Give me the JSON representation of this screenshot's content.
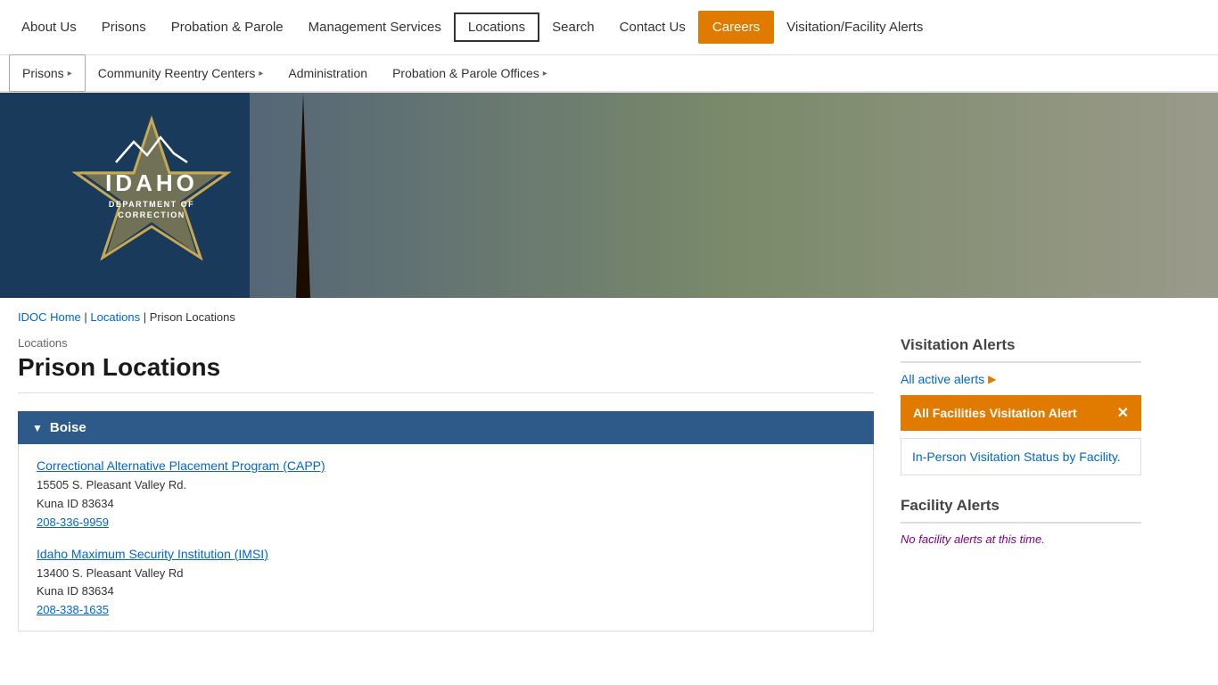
{
  "nav": {
    "items": [
      {
        "label": "About Us",
        "href": "#"
      },
      {
        "label": "Prisons",
        "href": "#"
      },
      {
        "label": "Probation & Parole",
        "href": "#"
      },
      {
        "label": "Management Services",
        "href": "#"
      },
      {
        "label": "Locations",
        "href": "#"
      },
      {
        "label": "Search",
        "href": "#"
      },
      {
        "label": "Contact Us",
        "href": "#"
      },
      {
        "label": "Careers",
        "href": "#"
      },
      {
        "label": "Visitation/Facility Alerts",
        "href": "#"
      }
    ]
  },
  "subnav": {
    "items": [
      {
        "label": "Prisons",
        "active": true
      },
      {
        "label": "Community Reentry Centers"
      },
      {
        "label": "Administration"
      },
      {
        "label": "Probation & Parole Offices"
      }
    ]
  },
  "logo": {
    "title_line1": "IDAHO",
    "title_line2": "DEPARTMENT OF",
    "title_line3": "CORRECTION"
  },
  "breadcrumb": {
    "home": "IDOC Home",
    "separator1": " | ",
    "locations": "Locations",
    "separator2": " | ",
    "current": "Prison Locations"
  },
  "page": {
    "category": "Locations",
    "title": "Prison Locations"
  },
  "locations": [
    {
      "city": "Boise",
      "facilities": [
        {
          "name": "Correctional Alternative Placement Program (CAPP)",
          "address1": "15505 S. Pleasant Valley Rd.",
          "address2": "Kuna ID 83634",
          "phone": "208-336-9959"
        },
        {
          "name": "Idaho Maximum Security Institution (IMSI)",
          "address1": "13400 S. Pleasant Valley Rd",
          "address2": "Kuna ID 83634",
          "phone": "208-338-1635"
        }
      ]
    }
  ],
  "sidebar": {
    "visitation_title": "Visitation Alerts",
    "all_alerts_link": "All active alerts",
    "alert_banner_label": "All Facilities Visitation Alert",
    "alert_detail_link": "In-Person Visitation Status by Facility.",
    "facility_alerts_title": "Facility Alerts",
    "no_facility_alerts": "No facility alerts at this time."
  }
}
